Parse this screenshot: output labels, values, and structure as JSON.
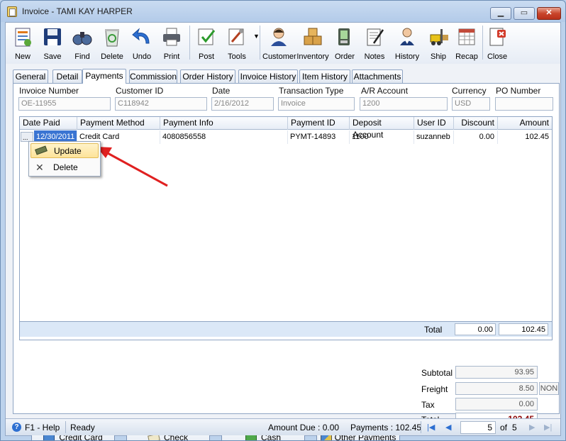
{
  "window": {
    "title": "Invoice - TAMI KAY HARPER"
  },
  "toolbar": {
    "items": [
      {
        "label": "New",
        "icon": "new-document-icon"
      },
      {
        "label": "Save",
        "icon": "floppy-disk-icon"
      },
      {
        "label": "Find",
        "icon": "binoculars-icon"
      },
      {
        "label": "Delete",
        "icon": "recycle-bin-icon"
      },
      {
        "label": "Undo",
        "icon": "undo-arrow-icon"
      },
      {
        "label": "Print",
        "icon": "printer-icon"
      },
      {
        "label": "Post",
        "icon": "post-check-icon"
      },
      {
        "label": "Tools",
        "icon": "tools-icon"
      },
      {
        "label": "Customer",
        "icon": "customer-person-icon"
      },
      {
        "label": "Inventory",
        "icon": "boxes-icon"
      },
      {
        "label": "Order",
        "icon": "order-icon"
      },
      {
        "label": "Notes",
        "icon": "notepad-icon"
      },
      {
        "label": "History",
        "icon": "history-person-icon"
      },
      {
        "label": "Ship",
        "icon": "forklift-icon"
      },
      {
        "label": "Recap",
        "icon": "recap-table-icon"
      },
      {
        "label": "Close",
        "icon": "close-door-icon"
      }
    ]
  },
  "tabs": [
    "General",
    "Detail",
    "Payments",
    "Commission",
    "Order History",
    "Invoice History",
    "Item History",
    "Attachments"
  ],
  "header": {
    "invoice_number": {
      "label": "Invoice Number",
      "value": "OE-11955"
    },
    "customer_id": {
      "label": "Customer ID",
      "value": "C118942"
    },
    "date": {
      "label": "Date",
      "value": "2/16/2012"
    },
    "transaction_type": {
      "label": "Transaction Type",
      "value": "Invoice"
    },
    "ar_account": {
      "label": "A/R Account",
      "value": "1200"
    },
    "currency": {
      "label": "Currency",
      "value": "USD"
    },
    "po_number": {
      "label": "PO Number",
      "value": ""
    }
  },
  "grid": {
    "columns": [
      "Date Paid",
      "Payment Method",
      "Payment Info",
      "Payment ID",
      "Deposit Account",
      "User ID",
      "Discount",
      "Amount"
    ],
    "rows": [
      {
        "date_paid": "12/30/2011",
        "ellipsis": "...",
        "payment_method": "Credit Card",
        "payment_info": "4080856558",
        "payment_id": "PYMT-14893",
        "deposit_account": "1100",
        "user_id": "suzanneb",
        "discount": "0.00",
        "amount": "102.45"
      }
    ],
    "footer": {
      "label": "Total",
      "discount": "0.00",
      "amount": "102.45"
    }
  },
  "context_menu": {
    "items": [
      {
        "label": "Update",
        "icon": "pencil-icon"
      },
      {
        "label": "Delete",
        "icon": "x-icon"
      }
    ]
  },
  "payment_buttons": [
    {
      "label": "Credit Card",
      "icon": "credit-card-icon"
    },
    {
      "label": "Check",
      "icon": "check-icon"
    },
    {
      "label": "Cash",
      "icon": "cash-icon"
    },
    {
      "label": "Other Payments",
      "icon": "other-payments-icon"
    }
  ],
  "totals": {
    "subtotal": {
      "label": "Subtotal",
      "value": "93.95"
    },
    "freight": {
      "label": "Freight",
      "value": "8.50",
      "term": "NON"
    },
    "tax": {
      "label": "Tax",
      "value": "0.00"
    },
    "total": {
      "label": "Total",
      "value": "102.45"
    }
  },
  "status": {
    "help": "F1 - Help",
    "state": "Ready",
    "amount_due": "Amount Due : 0.00",
    "payments": "Payments : 102.45",
    "page": "5",
    "of": "of",
    "total_pages": "5"
  },
  "colors": {
    "total_red": "#8b0000",
    "accent_arrow": "#e02020"
  }
}
